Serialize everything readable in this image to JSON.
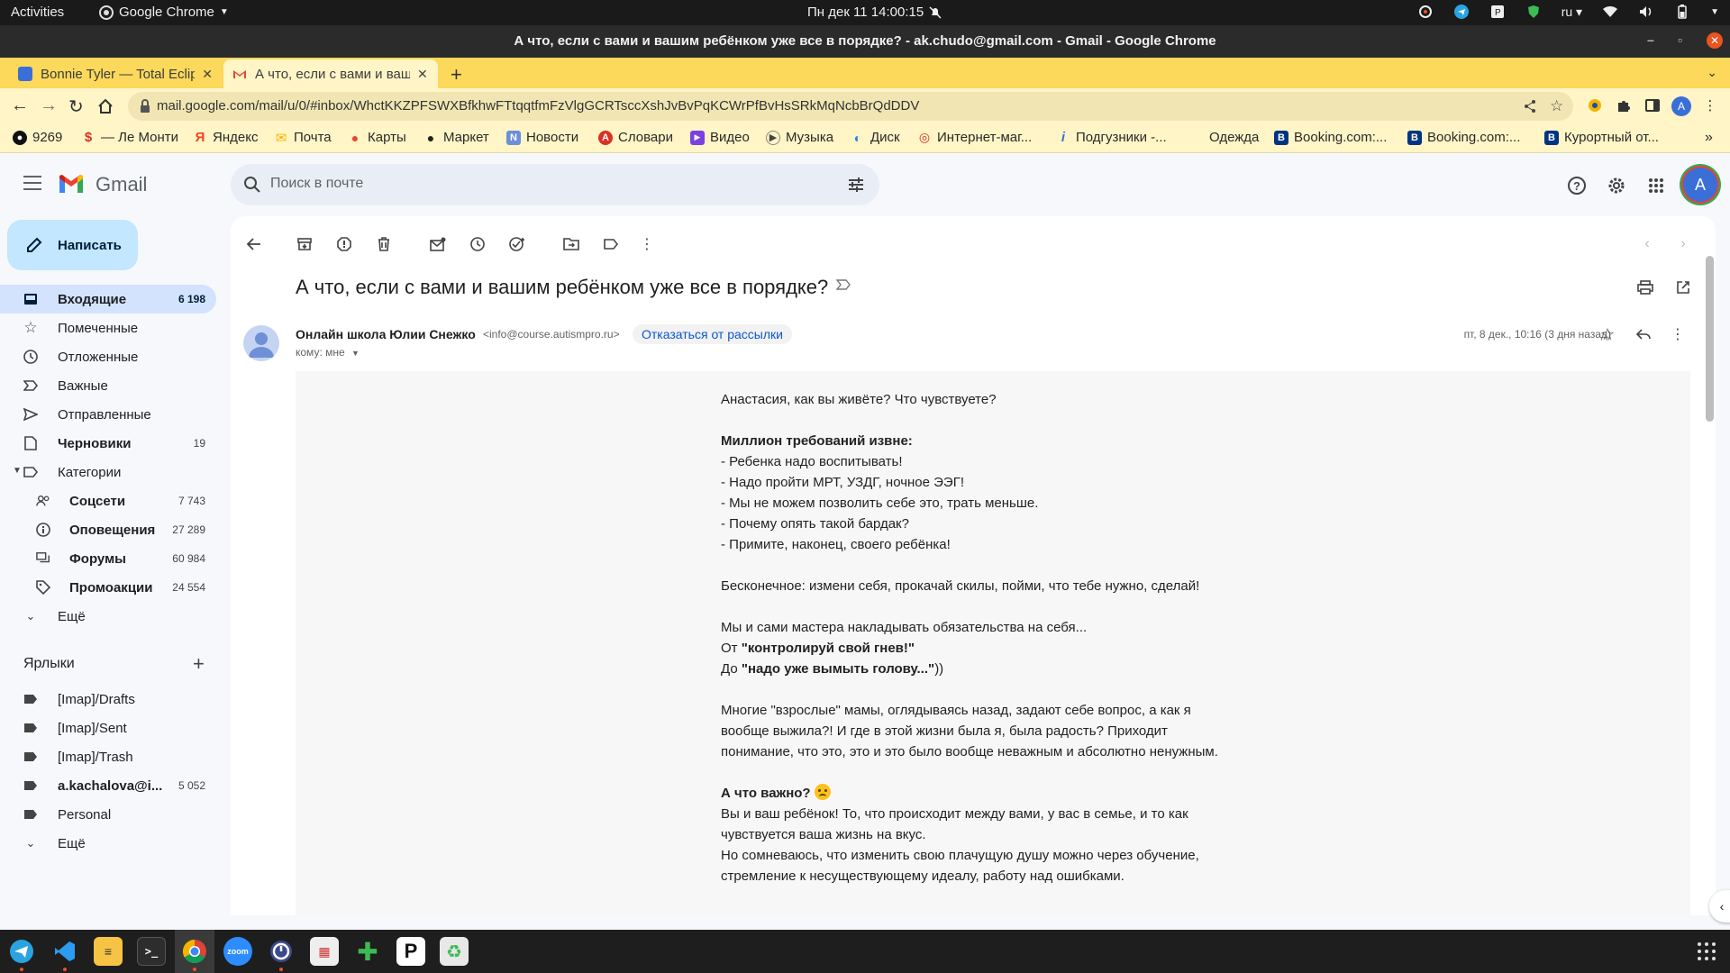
{
  "os": {
    "activities": "Activities",
    "app_name": "Google Chrome",
    "clock": "Пн дек 11  14:00:15",
    "lang": "ru"
  },
  "window": {
    "title": "А что, если с вами и вашим ребёнком уже все в порядке? - ak.chudo@gmail.com - Gmail - Google Chrome"
  },
  "tabs": [
    {
      "title": "Bonnie Tyler — Total Eclipse",
      "favicon_color": "#3b6fd8"
    },
    {
      "title": "А что, если с вами и вашим ребёнком уже все в порядке?",
      "favicon_color": "#ea4335"
    }
  ],
  "address": {
    "url": "mail.google.com/mail/u/0/#inbox/WhctKKZPFSWXBfkhwFTtqqtfmFzVlgGCRTsccXshJvBvPqKCWrPfBvHsSRkMqNcbBrQdDDV"
  },
  "profile_initial": "A",
  "bookmarks": [
    {
      "label": "9269",
      "icon": "github-icon",
      "color": "#111111",
      "glyph": "●"
    },
    {
      "label": "— Ле Монти",
      "icon": "dollar-icon",
      "color": "#d93025",
      "glyph": "$"
    },
    {
      "label": "Яндекс",
      "icon": "yandex-icon",
      "color": "#fc3f1d",
      "glyph": "Я"
    },
    {
      "label": "Почта",
      "icon": "mail-icon",
      "color": "#f7b600",
      "glyph": "✉"
    },
    {
      "label": "Карты",
      "icon": "map-pin-icon",
      "color": "#ea4335",
      "glyph": "●"
    },
    {
      "label": "Маркет",
      "icon": "market-icon",
      "color": "#ffcc00",
      "glyph": "●"
    },
    {
      "label": "Новости",
      "icon": "news-icon",
      "color": "#3b6fd8",
      "glyph": "N"
    },
    {
      "label": "Словари",
      "icon": "dictionary-icon",
      "color": "#d93025",
      "glyph": "A"
    },
    {
      "label": "Видео",
      "icon": "video-icon",
      "color": "#7b3fe4",
      "glyph": "▶"
    },
    {
      "label": "Музыка",
      "icon": "music-icon",
      "color": "#444444",
      "glyph": "▶"
    },
    {
      "label": "Диск",
      "icon": "disk-icon",
      "color": "#2b7de9",
      "glyph": "◐"
    },
    {
      "label": "Интернет-маг...",
      "icon": "shop-icon",
      "color": "#d93025",
      "glyph": "◎"
    },
    {
      "label": "Подгузники -...",
      "icon": "info-icon",
      "color": "#3b6fd8",
      "glyph": "i"
    },
    {
      "label": "Одежда",
      "icon": "blank-icon",
      "color": "#fff5c6",
      "glyph": ""
    },
    {
      "label": "Booking.com:...",
      "icon": "booking-icon",
      "color": "#003580",
      "glyph": "B"
    },
    {
      "label": "Booking.com:...",
      "icon": "booking-icon",
      "color": "#003580",
      "glyph": "B"
    },
    {
      "label": "Курортный от...",
      "icon": "booking-icon",
      "color": "#003580",
      "glyph": "B"
    }
  ],
  "gmail": {
    "logo_text": "Gmail",
    "search_placeholder": "Поиск в почте",
    "avatar_initial": "A",
    "compose": "Написать",
    "folders": [
      {
        "label": "Входящие",
        "count": "6 198",
        "icon": "inbox-icon",
        "active": true,
        "bold": true
      },
      {
        "label": "Помеченные",
        "count": "",
        "icon": "star-icon"
      },
      {
        "label": "Отложенные",
        "count": "",
        "icon": "clock-icon"
      },
      {
        "label": "Важные",
        "count": "",
        "icon": "important-icon"
      },
      {
        "label": "Отправленные",
        "count": "",
        "icon": "send-icon"
      },
      {
        "label": "Черновики",
        "count": "19",
        "icon": "draft-icon",
        "bold": true
      },
      {
        "label": "Категории",
        "count": "",
        "icon": "label-icon",
        "expand": true
      }
    ],
    "categories": [
      {
        "label": "Соцсети",
        "count": "7 743",
        "icon": "people-icon"
      },
      {
        "label": "Оповещения",
        "count": "27 289",
        "icon": "info-icon"
      },
      {
        "label": "Форумы",
        "count": "60 984",
        "icon": "forum-icon"
      },
      {
        "label": "Промоакции",
        "count": "24 554",
        "icon": "tag-icon"
      }
    ],
    "more": "Ещё",
    "labels_header": "Ярлыки",
    "labels": [
      {
        "label": "[Imap]/Drafts",
        "count": ""
      },
      {
        "label": "[Imap]/Sent",
        "count": ""
      },
      {
        "label": "[Imap]/Trash",
        "count": ""
      },
      {
        "label": "a.kachalova@i...",
        "count": "5 052",
        "bold": true
      },
      {
        "label": "Personal",
        "count": ""
      }
    ],
    "labels_more": "Ещё"
  },
  "message": {
    "subject": "А что, если с вами и вашим ребёнком уже все в порядке?",
    "sender_name": "Онлайн школа Юлии Снежко",
    "sender_email": "<info@course.autismpro.ru>",
    "unsubscribe": "Отказаться от рассылки",
    "to": "кому: мне",
    "date": "пт, 8 дек., 10:16 (3 дня назад)",
    "body": {
      "l1": "Анастасия, как вы живёте? Что чувствуете?",
      "h1": "Миллион требований извне:",
      "b1": "- Ребенка надо воспитывать!",
      "b2": "- Надо пройти МРТ, УЗДГ, ночное ЭЭГ!",
      "b3": "- Мы не можем позволить себе это, трать меньше.",
      "b4": "- Почему опять такой бардак?",
      "b5": "- Примите, наконец, своего ребёнка!",
      "p2": "Бесконечное: измени себя, прокачай скилы, пойми, что тебе нужно, сделай!",
      "p3": "Мы и сами мастера накладывать обязательства на себя...",
      "p3a_pre": "От ",
      "p3a_bold": "\"контролируй свой гнев!\"",
      "p3b_pre": "До ",
      "p3b_bold": "\"надо уже вымыть голову...\"",
      "p3b_post": "))",
      "p4a": "Многие \"взрослые\" мамы, оглядываясь назад,  задают себе вопрос, а как я",
      "p4b": "вообще выжила?! И где в этой жизни была я, была радость? Приходит",
      "p4c": "понимание, что это, это и это было вообще неважным и абсолютно ненужным.",
      "h2": "А что важно?",
      "p5a": "Вы и ваш ребёнок! То, что происходит между вами, у вас в семье, и то как",
      "p5b": "чувствуется ваша жизнь на вкус.",
      "p5c": "Но сомневаюсь, что изменить свою плачущую душу можно через обучение,",
      "p5d": "стремление к несуществующему идеалу, работу над ошибками."
    }
  },
  "dock": [
    {
      "name": "telegram",
      "color": "#2aa3e0",
      "glyph": "✈",
      "run": true
    },
    {
      "name": "vscode",
      "color": "#1e1e1e",
      "glyph": "",
      "run": true
    },
    {
      "name": "notes",
      "color": "#f6c344",
      "glyph": "≡",
      "run": false
    },
    {
      "name": "terminal",
      "color": "#2d2d2d",
      "glyph": ">_",
      "run": false
    },
    {
      "name": "chrome",
      "color": "#1e1e1e",
      "glyph": "",
      "run": true
    },
    {
      "name": "zoom",
      "color": "#2d8cff",
      "glyph": "zoom",
      "run": false
    },
    {
      "name": "timer",
      "color": "#1e1e1e",
      "glyph": "◔",
      "run": true
    },
    {
      "name": "calendar",
      "color": "#ffffff",
      "glyph": "▦",
      "run": false
    },
    {
      "name": "puzzle",
      "color": "#1e1e1e",
      "glyph": "✚",
      "run": false
    },
    {
      "name": "pcloud",
      "color": "#ffffff",
      "glyph": "P",
      "run": false
    },
    {
      "name": "trash",
      "color": "#1e1e1e",
      "glyph": "♻",
      "run": false
    }
  ]
}
